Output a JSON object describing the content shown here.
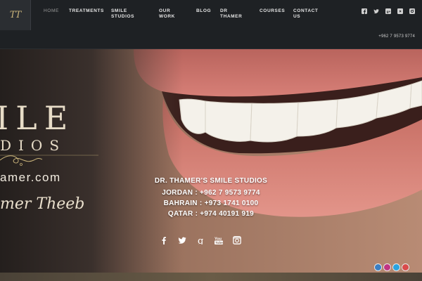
{
  "header": {
    "logo_text": "TT",
    "nav": [
      {
        "label": "HOME",
        "active": true
      },
      {
        "label": "TREATMENTS",
        "active": false
      },
      {
        "label": "SMILE STUDIOS",
        "active": false
      },
      {
        "label": "OUR WORK",
        "active": false
      },
      {
        "label": "BLOG",
        "active": false
      },
      {
        "label": "DR THAMER",
        "active": false
      },
      {
        "label": "COURSES",
        "active": false
      },
      {
        "label": "CONTACT US",
        "active": false
      }
    ],
    "social_icons": [
      "facebook-icon",
      "twitter-icon",
      "google-plus-icon",
      "youtube-icon",
      "instagram-icon"
    ],
    "phone": "+962 7 9573 9774"
  },
  "hero": {
    "banner_smile": "ILE",
    "banner_studios": "DIOS",
    "banner_site": "amer.com",
    "banner_signature": "mer Theeb",
    "info": {
      "title": "DR. THAMER'S SMILE STUDIOS",
      "lines": [
        "JORDAN : +962 7 9573 9774",
        "BAHRAIN : +973 1741 0100",
        "QATAR : +974 40191 919"
      ]
    },
    "social_icons": [
      "facebook-icon",
      "twitter-icon",
      "google-plus-icon",
      "youtube-icon",
      "instagram-icon"
    ]
  },
  "floating_icons": [
    {
      "name": "facebook-round-icon",
      "color": "#3b7fc4"
    },
    {
      "name": "instagram-round-icon",
      "color": "#c13584"
    },
    {
      "name": "twitter-round-icon",
      "color": "#2aa3e0"
    },
    {
      "name": "youtube-round-icon",
      "color": "#d94b4b"
    }
  ],
  "colors": {
    "header_bg": "#1e2124",
    "gold": "#c9b37a",
    "text": "#ffffff"
  }
}
